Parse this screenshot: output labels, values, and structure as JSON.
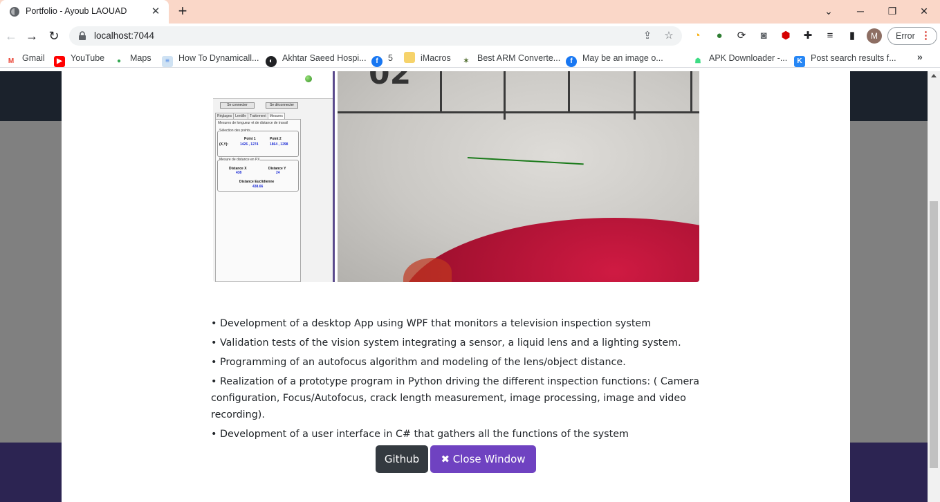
{
  "browser": {
    "tab_title": "Portfolio - Ayoub LAOUAD",
    "tab_close": "✕",
    "new_tab": "+",
    "url": "localhost:7044",
    "profile_initial": "M",
    "error_label": "Error",
    "error_dots": "⋮"
  },
  "bookmarks": [
    {
      "label": "Gmail",
      "icon": "gmail-icon",
      "color": "#ea4335",
      "glyph": "M"
    },
    {
      "label": "YouTube",
      "icon": "youtube-icon",
      "color": "#ff0000",
      "glyph": "▶"
    },
    {
      "label": "Maps",
      "icon": "maps-icon",
      "color": "#34a853",
      "glyph": "●"
    },
    {
      "label": "How To Dynamicall...",
      "icon": "page-icon",
      "color": "#9fc5e8",
      "glyph": "≡"
    },
    {
      "label": "Akhtar Saeed Hospi...",
      "icon": "globe-icon",
      "color": "#202124",
      "glyph": "◐"
    },
    {
      "label": "5",
      "icon": "facebook-icon",
      "color": "#1877f2",
      "glyph": "f"
    },
    {
      "label": "iMacros",
      "icon": "folder-icon",
      "color": "#f6d36b",
      "glyph": ""
    },
    {
      "label": "Best ARM Converte...",
      "icon": "arm-icon",
      "color": "#4e6b2c",
      "glyph": "✶"
    },
    {
      "label": "May be an image o...",
      "icon": "facebook-icon",
      "color": "#1877f2",
      "glyph": "f"
    },
    {
      "label": "APK Downloader -...",
      "icon": "android-icon",
      "color": "#3ddc84",
      "glyph": "☗"
    },
    {
      "label": "Post search results f...",
      "icon": "vk-icon",
      "color": "#2787f5",
      "glyph": "K"
    }
  ],
  "bookmarks_more": "»",
  "screenshot_app": {
    "connect": "Se connecter",
    "disconnect": "Se déconnecter",
    "tabs": [
      "Réglages",
      "Lentille",
      "Traitement",
      "Mesures"
    ],
    "section_title": "Mesures de longueur et de distance de travail",
    "selection_title": "Sélection des points",
    "point1_label": "Point 1",
    "point2_label": "Point 2",
    "xy_label": "(X,Y):",
    "point1_value": "1426 , 1274",
    "point2_value": "1864 , 1298",
    "distance_title": "Mesure de distance en PX",
    "dist_x_label": "Distance X",
    "dist_y_label": "Distance Y",
    "dist_x_value": "438",
    "dist_y_value": "24",
    "euclid_label": "Distance Euclidienne",
    "euclid_value": "438.66",
    "ruler_digits": "02"
  },
  "bullets": [
    "• Development of a desktop App using WPF that monitors a television inspection system",
    "• Validation tests of the vision system integrating a sensor, a liquid lens and a lighting system.",
    "• Programming of an autofocus algorithm and modeling of the lens/object distance.",
    "• Realization of a prototype program in Python driving the different inspection functions: ( Camera configuration, Focus/Autofocus, crack length measurement, image processing, image and video recording).",
    "• Development of a user interface in C# that gathers all the functions of the system"
  ],
  "buttons": {
    "github": "Github",
    "close": "✖ Close Window"
  },
  "colors": {
    "tab_strip": "#fad7c8",
    "github_button": "#343a40",
    "close_button": "#6f42c1",
    "page_header": "#1b222c",
    "page_footer": "#2c2452"
  }
}
